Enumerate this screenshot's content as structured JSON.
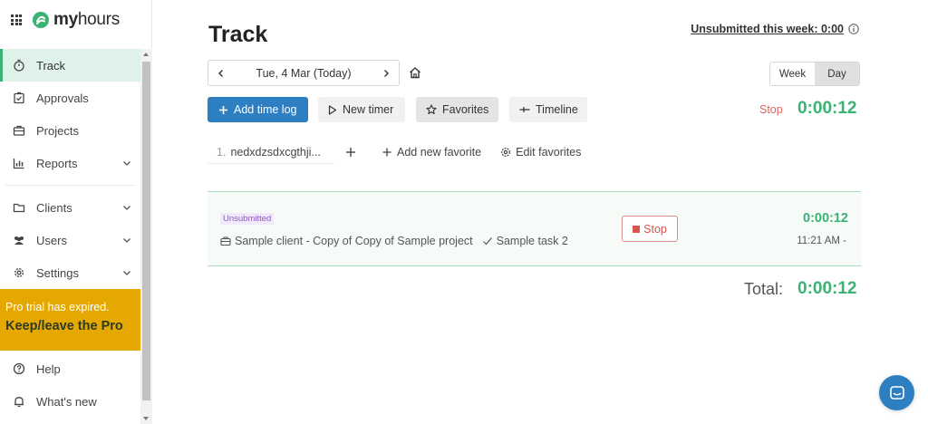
{
  "app": {
    "logo_text_bold": "my",
    "logo_text_rest": "hours"
  },
  "sidebar": {
    "items": [
      {
        "label": "Track",
        "icon": "stopwatch-icon",
        "active": true
      },
      {
        "label": "Approvals",
        "icon": "clipboard-check-icon"
      },
      {
        "label": "Projects",
        "icon": "briefcase-icon"
      },
      {
        "label": "Reports",
        "icon": "bar-chart-icon",
        "expandable": true
      },
      {
        "label": "Clients",
        "icon": "folder-icon",
        "expandable": true
      },
      {
        "label": "Users",
        "icon": "users-icon",
        "expandable": true
      },
      {
        "label": "Settings",
        "icon": "gear-icon",
        "expandable": true
      }
    ],
    "trial": {
      "line1": "Pro trial has expired.",
      "line2": "Keep/leave the Pro"
    },
    "bottom_items": [
      {
        "label": "Help",
        "icon": "question-circle-icon"
      },
      {
        "label": "What's new",
        "icon": "bell-icon"
      }
    ]
  },
  "header": {
    "title": "Track",
    "unsubmitted_week": "Unsubmitted this week: 0:00"
  },
  "date_nav": {
    "date": "Tue, 4 Mar (Today)"
  },
  "view_toggle": {
    "week": "Week",
    "day": "Day",
    "selected": "Day"
  },
  "toolbar": {
    "add_time_log": "Add time log",
    "new_timer": "New timer",
    "favorites": "Favorites",
    "timeline": "Timeline",
    "stop": "Stop",
    "timer": "0:00:12"
  },
  "favorites_row": {
    "chip_number": "1.",
    "chip_label": "nedxdzsdxcgthji...",
    "add_new": "Add new favorite",
    "edit": "Edit favorites"
  },
  "entry": {
    "status": "Unsubmitted",
    "project": "Sample client - Copy of Copy of Sample project",
    "task": "Sample task 2",
    "stop": "Stop",
    "timer": "0:00:12",
    "time_range": "11:21 AM -"
  },
  "total": {
    "label": "Total:",
    "value": "0:00:12"
  },
  "colors": {
    "accent_green": "#3bb273",
    "primary_blue": "#2d7fc1",
    "trial_yellow": "#e5a800",
    "stop_red": "#d9534f"
  }
}
